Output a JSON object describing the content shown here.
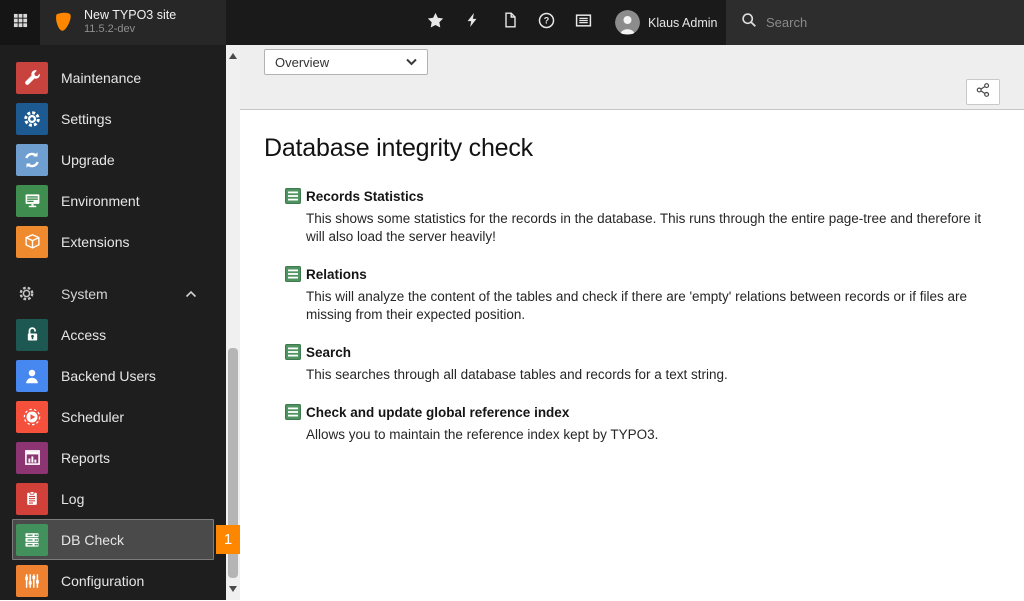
{
  "topbar": {
    "site_name": "New TYPO3 site",
    "site_version": "11.5.2-dev",
    "user_name": "Klaus Admin",
    "search_placeholder": "Search",
    "toolbar": [
      {
        "name": "star"
      },
      {
        "name": "bolt"
      },
      {
        "name": "file"
      },
      {
        "name": "help"
      },
      {
        "name": "list-alt"
      }
    ]
  },
  "sidebar": {
    "rows": [
      {
        "kind": "module",
        "label": "Maintenance",
        "icon": "wrench",
        "color": "#c8423e"
      },
      {
        "kind": "module",
        "label": "Settings",
        "icon": "gear",
        "color": "#1d5a91"
      },
      {
        "kind": "module",
        "label": "Upgrade",
        "icon": "refresh",
        "color": "#6e9fd0"
      },
      {
        "kind": "module",
        "label": "Environment",
        "icon": "monitor",
        "color": "#3f8d4f"
      },
      {
        "kind": "module",
        "label": "Extensions",
        "icon": "cube",
        "color": "#ef8a2f"
      },
      {
        "kind": "section",
        "label": "System",
        "icon": "gear-outline",
        "state": "expanded"
      },
      {
        "kind": "module",
        "label": "Access",
        "icon": "lock-open",
        "color": "#1d5952"
      },
      {
        "kind": "module",
        "label": "Backend Users",
        "icon": "user",
        "color": "#4787f0"
      },
      {
        "kind": "module",
        "label": "Scheduler",
        "icon": "scheduler",
        "color": "#f4503c"
      },
      {
        "kind": "module",
        "label": "Reports",
        "icon": "chart",
        "color": "#8c3572"
      },
      {
        "kind": "module",
        "label": "Log",
        "icon": "clipboard",
        "color": "#d2403a"
      },
      {
        "kind": "module",
        "label": "DB Check",
        "icon": "dbstack",
        "color": "#42905c",
        "active": true,
        "badge": "1"
      },
      {
        "kind": "module",
        "label": "Configuration",
        "icon": "sliders",
        "color": "#ee8231"
      }
    ]
  },
  "docheader": {
    "function_select_value": "Overview"
  },
  "main": {
    "title": "Database integrity check",
    "checks": [
      {
        "title": "Records Statistics",
        "description": "This shows some statistics for the records in the database. This runs through the entire page-tree and therefore it will also load the server heavily!"
      },
      {
        "title": "Relations",
        "description": "This will analyze the content of the tables and check if there are 'empty' relations between records or if files are missing from their expected position."
      },
      {
        "title": "Search",
        "description": "This searches through all database tables and records for a text string."
      },
      {
        "title": "Check and update global reference index",
        "description": "Allows you to maintain the reference index kept by TYPO3."
      }
    ]
  },
  "colors": {
    "brand_orange": "#ff8700",
    "badge": "#ff8700",
    "topbar_bg": "#1a1a1a",
    "sidebar_bg": "#1e1e1e",
    "active_row_bg": "#4a4a4a",
    "docheader_bg": "#eeeeee",
    "check_icon_green": "#4e9360"
  }
}
